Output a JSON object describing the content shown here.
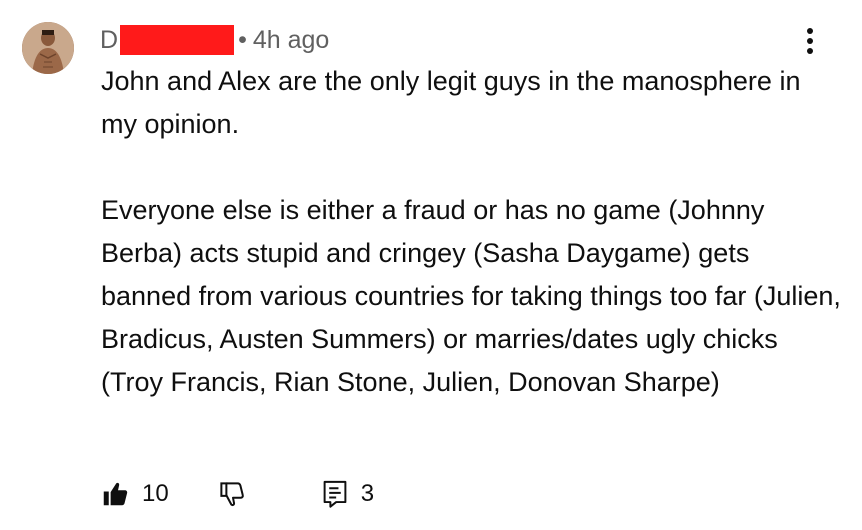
{
  "comment": {
    "author_prefix": "D",
    "separator": "•",
    "timestamp": "4h ago",
    "paragraphs": [
      "John and Alex are the only legit guys in the manosphere in my opinion.",
      "Everyone else is either a fraud or has no game (Johnny Berba) acts stupid and cringey (Sasha Daygame) gets banned from various countries for taking things too far (Julien, Bradicus, Austen Summers) or marries/dates ugly chicks (Troy Francis, Rian Stone, Julien, Donovan Sharpe)"
    ],
    "like_count": "10",
    "reply_count": "3"
  },
  "icons": {
    "like": "thumbs-up-filled-icon",
    "dislike": "thumbs-down-outline-icon",
    "reply": "comment-reply-icon",
    "more": "more-vertical-icon"
  },
  "colors": {
    "redaction": "#ff1a1a",
    "text": "#0f0f0f",
    "meta": "#606060"
  }
}
